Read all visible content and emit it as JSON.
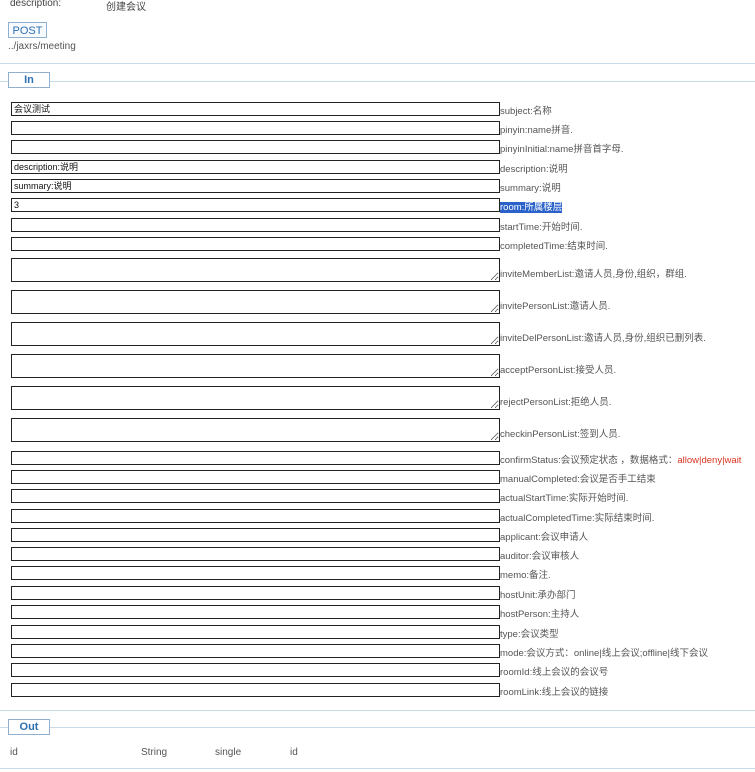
{
  "description": {
    "label": "description:",
    "value": "创建会议"
  },
  "method": "POST",
  "path": "../jaxrs/meeting",
  "in_section": {
    "tab": "In"
  },
  "out_section": {
    "tab": "Out"
  },
  "params": [
    {
      "value": "会议测试",
      "placeholder": "",
      "label": "subject:名称",
      "multiline": false
    },
    {
      "value": "",
      "placeholder": "",
      "label": "pinyin:name拼音.",
      "multiline": false
    },
    {
      "value": "",
      "placeholder": "",
      "label": "pinyinInitial:name拼音首字母.",
      "multiline": false
    },
    {
      "value": "description:说明",
      "placeholder": "",
      "label": "description:说明",
      "multiline": false
    },
    {
      "value": "summary:说明",
      "placeholder": "",
      "label": "summary:说明",
      "multiline": false
    },
    {
      "value": "3",
      "placeholder": "",
      "label": "room:所属楼层",
      "multiline": false,
      "highlight": true
    },
    {
      "value": "",
      "placeholder": "",
      "label": "startTime:开始时间.",
      "multiline": false
    },
    {
      "value": "",
      "placeholder": "",
      "label": "completedTime:结束时间.",
      "multiline": false
    },
    {
      "value": "",
      "placeholder": "",
      "label": "inviteMemberList:邀请人员,身份,组织，群组.",
      "multiline": true
    },
    {
      "value": "",
      "placeholder": "",
      "label": "invitePersonList:邀请人员.",
      "multiline": true
    },
    {
      "value": "",
      "placeholder": "",
      "label": "inviteDelPersonList:邀请人员,身份,组织已删列表.",
      "multiline": true
    },
    {
      "value": "",
      "placeholder": "",
      "label": "acceptPersonList:接受人员.",
      "multiline": true
    },
    {
      "value": "",
      "placeholder": "",
      "label": "rejectPersonList:拒绝人员.",
      "multiline": true
    },
    {
      "value": "",
      "placeholder": "",
      "label": "checkinPersonList:签到人员.",
      "multiline": true
    },
    {
      "value": "",
      "placeholder": "",
      "label": "confirmStatus:会议预定状态 ，数据格式：",
      "label_extra": "allow|deny|wait",
      "multiline": false
    },
    {
      "value": "",
      "placeholder": "",
      "label": "manualCompleted:会议是否手工结束",
      "multiline": false
    },
    {
      "value": "",
      "placeholder": "",
      "label": "actualStartTime:实际开始时间.",
      "multiline": false
    },
    {
      "value": "",
      "placeholder": "",
      "label": "actualCompletedTime:实际结束时间.",
      "multiline": false
    },
    {
      "value": "",
      "placeholder": "",
      "label": "applicant:会议申请人",
      "multiline": false
    },
    {
      "value": "",
      "placeholder": "",
      "label": "auditor:会议审核人",
      "multiline": false
    },
    {
      "value": "",
      "placeholder": "",
      "label": "memo:备注.",
      "multiline": false
    },
    {
      "value": "",
      "placeholder": "",
      "label": "hostUnit:承办部门",
      "multiline": false
    },
    {
      "value": "",
      "placeholder": "",
      "label": "hostPerson:主持人",
      "multiline": false
    },
    {
      "value": "",
      "placeholder": "",
      "label": "type:会议类型",
      "multiline": false
    },
    {
      "value": "",
      "placeholder": "",
      "label": "mode:会议方式：online|线上会议;offline|线下会议",
      "multiline": false
    },
    {
      "value": "",
      "placeholder": "",
      "label": "roomId:线上会议的会议号",
      "multiline": false
    },
    {
      "value": "",
      "placeholder": "",
      "label": "roomLink:线上会议的链接",
      "multiline": false
    }
  ],
  "out": [
    {
      "name": "id",
      "type": "String",
      "mode": "single",
      "desc": "id"
    }
  ]
}
